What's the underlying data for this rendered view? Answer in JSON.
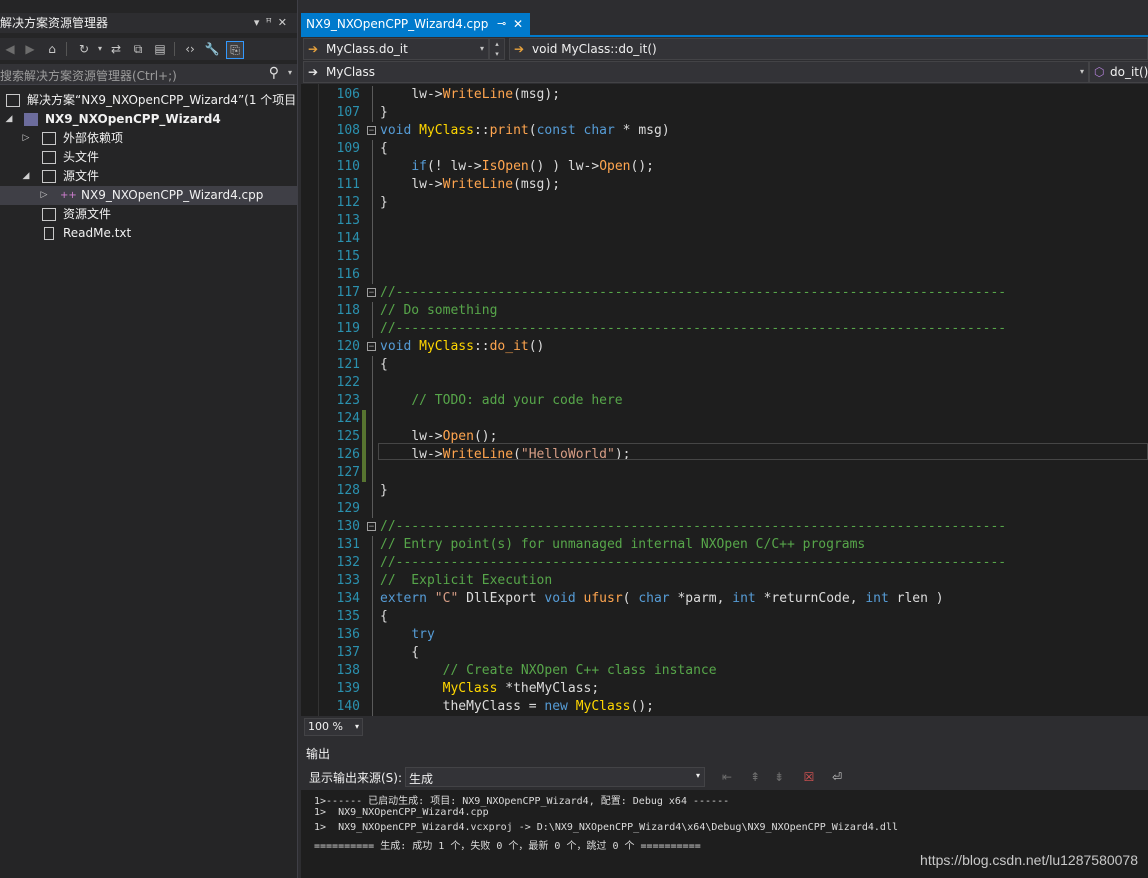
{
  "solution_explorer": {
    "title": "解决方案资源管理器",
    "search_placeholder": "搜索解决方案资源管理器(Ctrl+;)",
    "tree": [
      {
        "label": "解决方案“NX9_NXOpenCPP_Wizard4”(1 个项目",
        "icon": "solution-icon"
      },
      {
        "label": "NX9_NXOpenCPP_Wizard4",
        "icon": "cpp-project-icon"
      },
      {
        "label": "外部依赖项",
        "icon": "references-icon"
      },
      {
        "label": "头文件",
        "icon": "filter-folder-icon"
      },
      {
        "label": "源文件",
        "icon": "filter-folder-icon"
      },
      {
        "label": "NX9_NXOpenCPP_Wizard4.cpp",
        "icon": "cpp-file-icon"
      },
      {
        "label": "资源文件",
        "icon": "filter-folder-icon"
      },
      {
        "label": "ReadMe.txt",
        "icon": "text-file-icon"
      }
    ]
  },
  "editor": {
    "tab_name": "NX9_NXOpenCPP_Wizard4.cpp",
    "member_nav": "MyClass.do_it",
    "function_nav": "void MyClass::do_it()",
    "scope_nav": "MyClass",
    "right_nav": "do_it()",
    "zoom": "100 %",
    "lines": [
      {
        "n": "106",
        "t": "    lw->WriteLine(msg);"
      },
      {
        "n": "107",
        "t": "}"
      },
      {
        "n": "108",
        "t": "void MyClass::print(const char * msg)"
      },
      {
        "n": "109",
        "t": "{"
      },
      {
        "n": "110",
        "t": "    if(! lw->IsOpen() ) lw->Open();"
      },
      {
        "n": "111",
        "t": "    lw->WriteLine(msg);"
      },
      {
        "n": "112",
        "t": "}"
      },
      {
        "n": "113",
        "t": ""
      },
      {
        "n": "114",
        "t": ""
      },
      {
        "n": "115",
        "t": ""
      },
      {
        "n": "116",
        "t": ""
      },
      {
        "n": "117",
        "t": "//------------------------------------------------------------------------------"
      },
      {
        "n": "118",
        "t": "// Do something"
      },
      {
        "n": "119",
        "t": "//------------------------------------------------------------------------------"
      },
      {
        "n": "120",
        "t": "void MyClass::do_it()"
      },
      {
        "n": "121",
        "t": "{"
      },
      {
        "n": "122",
        "t": ""
      },
      {
        "n": "123",
        "t": "    // TODO: add your code here"
      },
      {
        "n": "124",
        "t": ""
      },
      {
        "n": "125",
        "t": "    lw->Open();"
      },
      {
        "n": "126",
        "t": "    lw->WriteLine(\"HelloWorld\");"
      },
      {
        "n": "127",
        "t": ""
      },
      {
        "n": "128",
        "t": "}"
      },
      {
        "n": "129",
        "t": ""
      },
      {
        "n": "130",
        "t": "//------------------------------------------------------------------------------"
      },
      {
        "n": "131",
        "t": "// Entry point(s) for unmanaged internal NXOpen C/C++ programs"
      },
      {
        "n": "132",
        "t": "//------------------------------------------------------------------------------"
      },
      {
        "n": "133",
        "t": "//  Explicit Execution"
      },
      {
        "n": "134",
        "t": "extern \"C\" DllExport void ufusr( char *parm, int *returnCode, int rlen )"
      },
      {
        "n": "135",
        "t": "{"
      },
      {
        "n": "136",
        "t": "    try"
      },
      {
        "n": "137",
        "t": "    {"
      },
      {
        "n": "138",
        "t": "        // Create NXOpen C++ class instance"
      },
      {
        "n": "139",
        "t": "        MyClass *theMyClass;"
      },
      {
        "n": "140",
        "t": "        theMyClass = new MyClass();"
      }
    ]
  },
  "output": {
    "title": "输出",
    "source_label": "显示输出来源(S):",
    "source_value": "生成",
    "lines": [
      "1>------ 已启动生成: 项目: NX9_NXOpenCPP_Wizard4, 配置: Debug x64 ------",
      "1>  NX9_NXOpenCPP_Wizard4.cpp",
      "1>  NX9_NXOpenCPP_Wizard4.vcxproj -> D:\\NX9_NXOpenCPP_Wizard4\\x64\\Debug\\NX9_NXOpenCPP_Wizard4.dll",
      "========== 生成: 成功 1 个，失败 0 个，最新 0 个，跳过 0 个 =========="
    ]
  },
  "watermark": "https://blog.csdn.net/lu1287580078"
}
